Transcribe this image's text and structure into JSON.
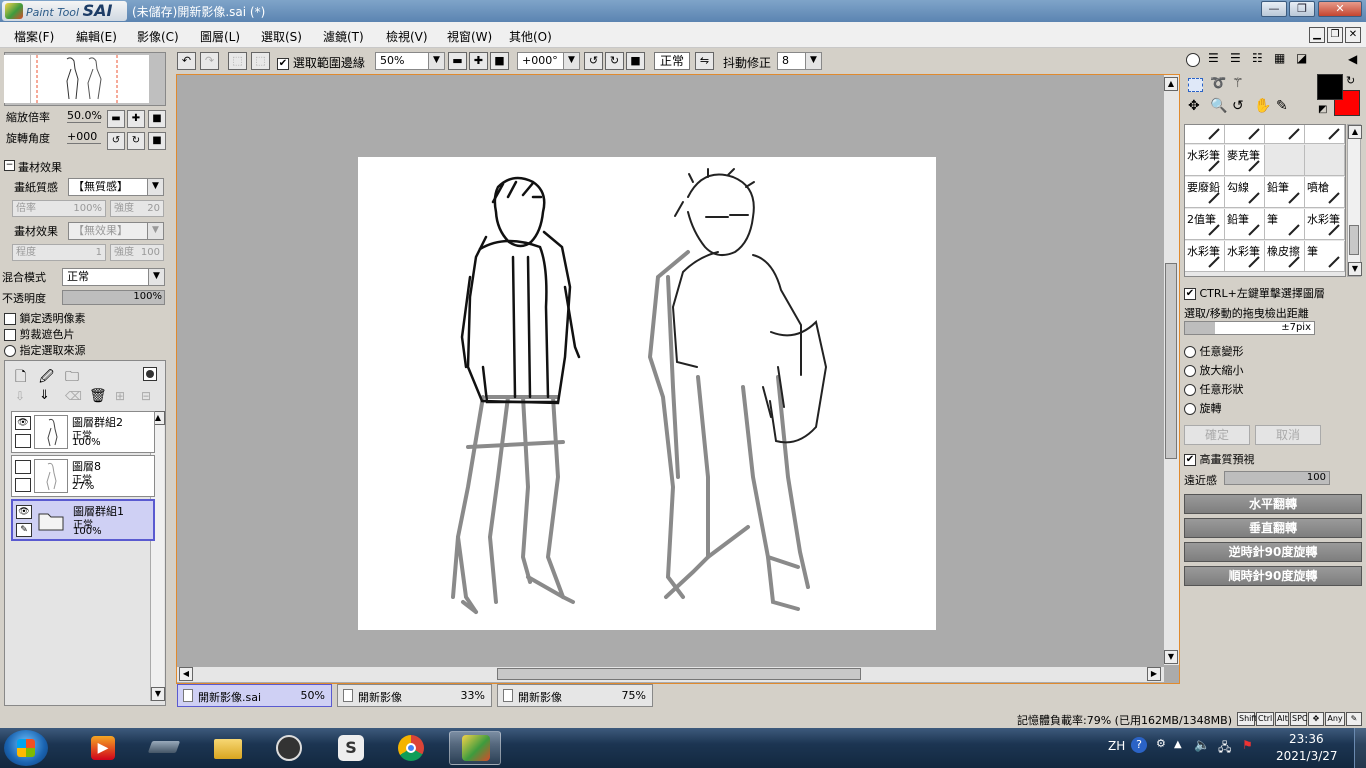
{
  "window": {
    "app_logo_text": "Paint Tool",
    "app_logo_brand": "SAI",
    "title": "(未儲存)開新影像.sai (*)",
    "min": "—",
    "max": "❐",
    "close": "✕"
  },
  "menu": {
    "items": [
      "檔案(F)",
      "編輯(E)",
      "影像(C)",
      "圖層(L)",
      "選取(S)",
      "濾鏡(T)",
      "檢視(V)",
      "視窗(W)",
      "其他(O)"
    ]
  },
  "left": {
    "zoom_label": "縮放倍率",
    "zoom_value": "50.0%",
    "rotate_label": "旋轉角度",
    "rotate_value": "+000",
    "effects_header": "畫材效果",
    "paper_texture_label": "畫紙質感",
    "paper_texture_value": "【無質感】",
    "scale_label": "倍率",
    "scale_value": "100%",
    "intensity_label": "強度",
    "intensity_value": "20",
    "material_label": "畫材效果",
    "material_value": "【無效果】",
    "degree_label": "程度",
    "degree_value": "1",
    "intensity2_label": "強度",
    "intensity2_value": "100",
    "blend_label": "混合模式",
    "blend_value": "正常",
    "opacity_label": "不透明度",
    "opacity_value": "100%",
    "opacity_fill": 1.0,
    "lock_alpha": "鎖定透明像素",
    "clip_mask": "剪裁遮色片",
    "select_source": "指定選取來源",
    "layers": [
      {
        "name": "圖層群組2",
        "mode": "正常",
        "opacity": "100%",
        "visible": true,
        "selected": false
      },
      {
        "name": "圖層8",
        "mode": "正常",
        "opacity": "27%",
        "visible": false,
        "selected": false
      },
      {
        "name": "圖層群組1",
        "mode": "正常",
        "opacity": "100%",
        "visible": true,
        "selected": true
      }
    ]
  },
  "toolbar": {
    "selection_edge_label": "選取範圍邊緣",
    "zoom_value": "50%",
    "angle_value": "+000°",
    "blend_value": "正常",
    "stabilizer_label": "抖動修正",
    "stabilizer_value": "8"
  },
  "tabs": [
    {
      "name": "開新影像.sai",
      "percent": "50%",
      "active": true
    },
    {
      "name": "開新影像",
      "percent": "33%",
      "active": false
    },
    {
      "name": "開新影像",
      "percent": "75%",
      "active": false
    }
  ],
  "right": {
    "brushes": [
      [
        "",
        "",
        "",
        ""
      ],
      [
        "水彩筆",
        "麥克筆",
        "",
        ""
      ],
      [
        "要廢鉛",
        "勾線",
        "鉛筆",
        "噴槍"
      ],
      [
        "2值筆",
        "鉛筆",
        "筆",
        "水彩筆"
      ],
      [
        "水彩筆",
        "水彩筆",
        "橡皮擦",
        "筆"
      ]
    ],
    "ctrl_select_label": "CTRL+左鍵單擊選擇圖層",
    "drag_distance_label": "選取/移動的拖曳檢出距離",
    "drag_distance_value": "±7pix",
    "transform_options": [
      "任意變形",
      "放大縮小",
      "任意形狀",
      "旋轉"
    ],
    "ok_label": "確定",
    "cancel_label": "取消",
    "hq_preview_label": "高畫質預視",
    "perspective_label": "遠近感",
    "perspective_value": "100",
    "flip_h": "水平翻轉",
    "flip_v": "垂直翻轉",
    "rotate_ccw": "逆時針90度旋轉",
    "rotate_cw": "順時針90度旋轉",
    "fg_color": "#000000",
    "bg_color": "#ff0000"
  },
  "status": {
    "memory": "記憶體負載率:79% (已用162MB/1348MB)",
    "keys": [
      "Shift",
      "Ctrl",
      "Alt",
      "SPC",
      "✥",
      "Any",
      "✎"
    ]
  },
  "taskbar": {
    "lang": "ZH",
    "time": "23:36",
    "date": "2021/3/27"
  }
}
